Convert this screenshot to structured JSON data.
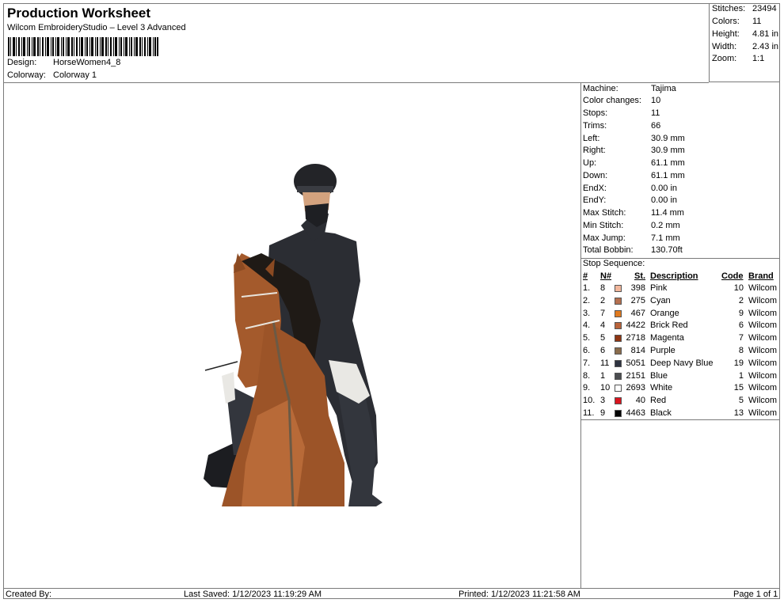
{
  "header": {
    "title": "Production Worksheet",
    "software": "Wilcom EmbroideryStudio – Level 3 Advanced",
    "design_label": "Design:",
    "design_value": "HorseWomen4_8",
    "colorway_label": "Colorway:",
    "colorway_value": "Colorway 1"
  },
  "summary": [
    {
      "label": "Stitches:",
      "value": "23494"
    },
    {
      "label": "Colors:",
      "value": "11"
    },
    {
      "label": "Height:",
      "value": "4.81 in"
    },
    {
      "label": "Width:",
      "value": "2.43 in"
    },
    {
      "label": "Zoom:",
      "value": "1:1"
    }
  ],
  "machine_info": [
    {
      "label": "Machine:",
      "value": "Tajima"
    },
    {
      "label": "Color changes:",
      "value": "10"
    },
    {
      "label": "Stops:",
      "value": "11"
    },
    {
      "label": "Trims:",
      "value": "66"
    },
    {
      "label": "Left:",
      "value": "30.9 mm"
    },
    {
      "label": "Right:",
      "value": "30.9 mm"
    },
    {
      "label": "Up:",
      "value": "61.1 mm"
    },
    {
      "label": "Down:",
      "value": "61.1 mm"
    },
    {
      "label": "EndX:",
      "value": "0.00 in"
    },
    {
      "label": "EndY:",
      "value": "0.00 in"
    },
    {
      "label": "Max Stitch:",
      "value": "11.4 mm"
    },
    {
      "label": "Min Stitch:",
      "value": "0.2 mm"
    },
    {
      "label": "Max Jump:",
      "value": "7.1 mm"
    },
    {
      "label": "Total Bobbin:",
      "value": "130.70ft"
    }
  ],
  "stop_sequence": {
    "title": "Stop Sequence:",
    "columns": [
      "#",
      "N#",
      "St.",
      "Description",
      "Code",
      "Brand"
    ],
    "rows": [
      {
        "idx": "1.",
        "n": "8",
        "color": "#f2b79c",
        "st": "398",
        "desc": "Pink",
        "code": "10",
        "brand": "Wilcom"
      },
      {
        "idx": "2.",
        "n": "2",
        "color": "#b5704f",
        "st": "275",
        "desc": "Cyan",
        "code": "2",
        "brand": "Wilcom"
      },
      {
        "idx": "3.",
        "n": "7",
        "color": "#e07a1f",
        "st": "467",
        "desc": "Orange",
        "code": "9",
        "brand": "Wilcom"
      },
      {
        "idx": "4.",
        "n": "4",
        "color": "#b9633a",
        "st": "4422",
        "desc": "Brick Red",
        "code": "6",
        "brand": "Wilcom"
      },
      {
        "idx": "5.",
        "n": "5",
        "color": "#8e3512",
        "st": "2718",
        "desc": "Magenta",
        "code": "7",
        "brand": "Wilcom"
      },
      {
        "idx": "6.",
        "n": "6",
        "color": "#8a6c4c",
        "st": "814",
        "desc": "Purple",
        "code": "8",
        "brand": "Wilcom"
      },
      {
        "idx": "7.",
        "n": "11",
        "color": "#2e3340",
        "st": "5051",
        "desc": "Deep Navy Blue",
        "code": "19",
        "brand": "Wilcom"
      },
      {
        "idx": "8.",
        "n": "1",
        "color": "#4b4d50",
        "st": "2151",
        "desc": "Blue",
        "code": "1",
        "brand": "Wilcom"
      },
      {
        "idx": "9.",
        "n": "10",
        "color": "#ffffff",
        "st": "2693",
        "desc": "White",
        "code": "15",
        "brand": "Wilcom"
      },
      {
        "idx": "10.",
        "n": "3",
        "color": "#d9141e",
        "st": "40",
        "desc": "Red",
        "code": "5",
        "brand": "Wilcom"
      },
      {
        "idx": "11.",
        "n": "9",
        "color": "#050505",
        "st": "4463",
        "desc": "Black",
        "code": "13",
        "brand": "Wilcom"
      }
    ]
  },
  "footer": {
    "created_by": "Created By:",
    "last_saved": "Last Saved: 1/12/2023 11:19:29 AM",
    "printed": "Printed: 1/12/2023 11:21:58 AM",
    "page": "Page 1 of 1"
  },
  "colors": {
    "border": "#7a7a7a",
    "horse": "#a45a2c",
    "rider": "#2b2d33"
  }
}
